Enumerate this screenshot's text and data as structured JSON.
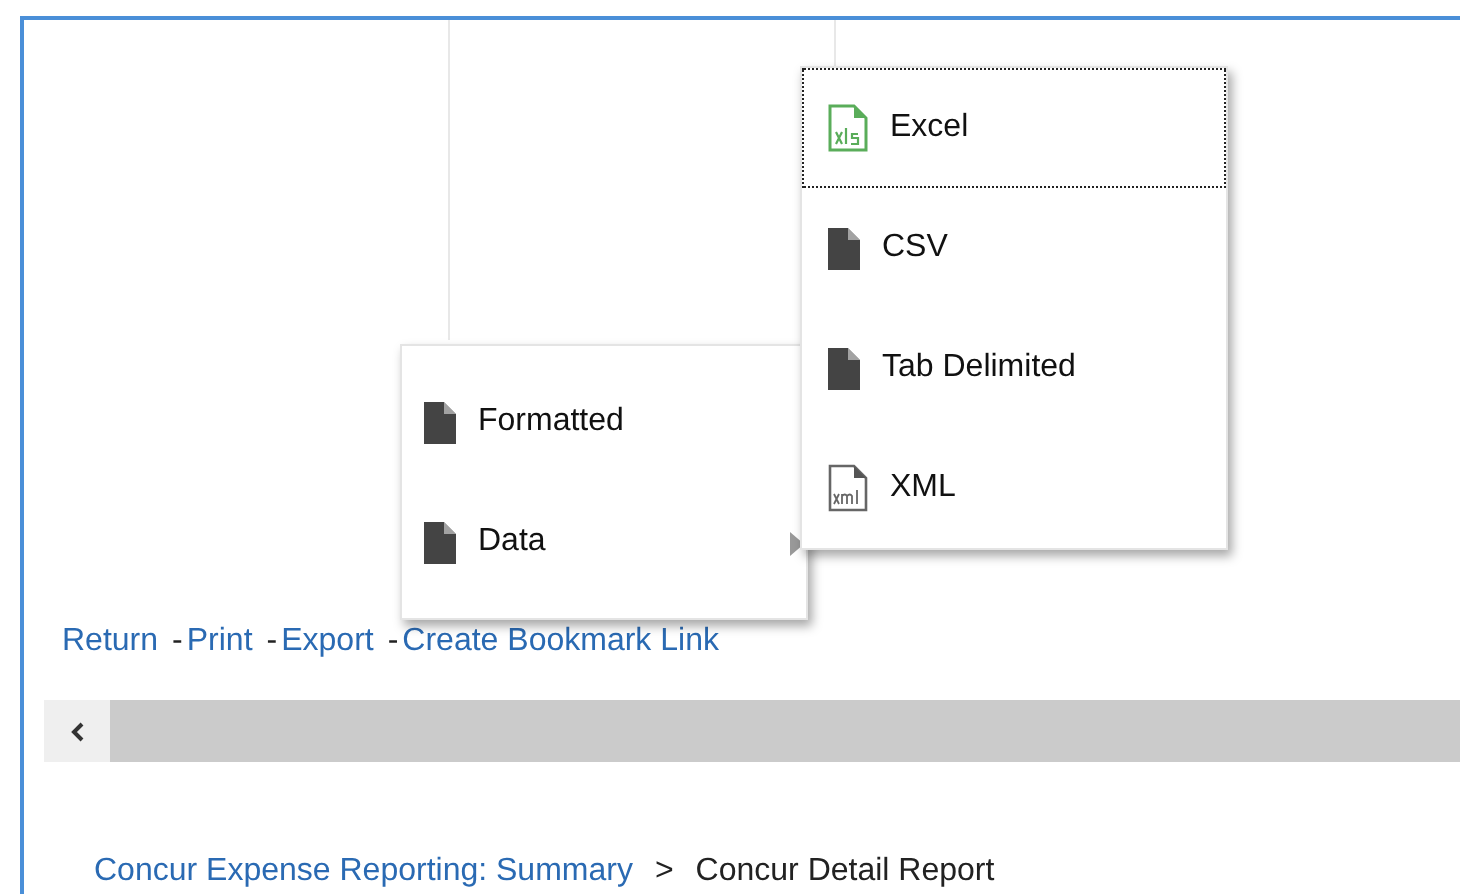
{
  "export_menu": {
    "items": [
      {
        "label": "Formatted",
        "kind": "document",
        "has_submenu": false
      },
      {
        "label": "Data",
        "kind": "document",
        "has_submenu": true
      }
    ]
  },
  "data_submenu": {
    "items": [
      {
        "label": "Excel",
        "kind": "xls",
        "focused": true
      },
      {
        "label": "CSV",
        "kind": "document",
        "focused": false
      },
      {
        "label": "Tab Delimited",
        "kind": "document",
        "focused": false
      },
      {
        "label": "XML",
        "kind": "xml",
        "focused": false
      }
    ]
  },
  "links": [
    {
      "label": "Return"
    },
    {
      "separator": "-",
      "label": "Print"
    },
    {
      "separator": "-",
      "label": "Export"
    },
    {
      "separator": "-",
      "label": "Create Bookmark Link"
    }
  ],
  "breadcrumb": [
    {
      "kind": "link",
      "label": "Concur Expense Reporting: Summary"
    },
    {
      "kind": "separator",
      "label": ">"
    },
    {
      "kind": "current",
      "label": "Concur Detail Report"
    }
  ]
}
